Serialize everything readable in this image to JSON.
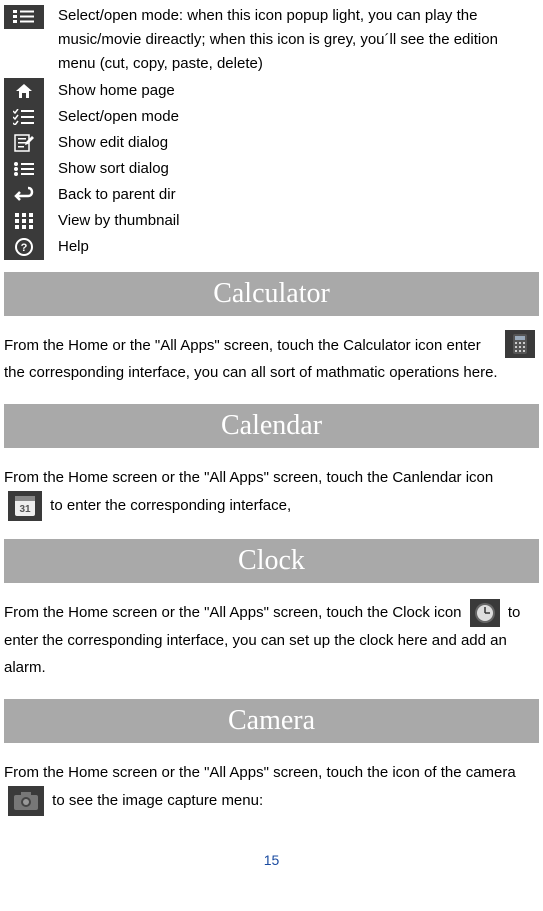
{
  "toolbar": {
    "select_open_desc": "Select/open mode: when this icon popup light, you can play the music/movie direactly; when this icon is grey, you´ll see the edition menu (cut, copy, paste, delete)",
    "items": [
      "Show home page",
      "Select/open mode",
      "Show edit dialog",
      "Show sort dialog",
      "Back to parent dir",
      "View by thumbnail",
      "Help"
    ]
  },
  "sections": {
    "calculator": {
      "title": "Calculator",
      "body_pre": "From the Home or the \"All Apps\" screen, touch the Calculator icon",
      "body_post": "enter the corresponding interface, you can all sort of mathmatic operations here."
    },
    "calendar": {
      "title": "Calendar",
      "body_pre": "From the Home screen or the \"All Apps\" screen, touch the Canlendar icon",
      "body_post": "to enter the corresponding interface,"
    },
    "clock": {
      "title": "Clock",
      "body_pre": "From the Home screen or the \"All Apps\" screen, touch the Clock icon",
      "body_post": "to enter the corresponding interface, you can set up the clock here and add an alarm."
    },
    "camera": {
      "title": "Camera",
      "body_pre": "From the Home screen or the \"All Apps\" screen, touch the icon of the camera",
      "body_post": "to see the image capture menu:"
    }
  },
  "page_number": "15"
}
